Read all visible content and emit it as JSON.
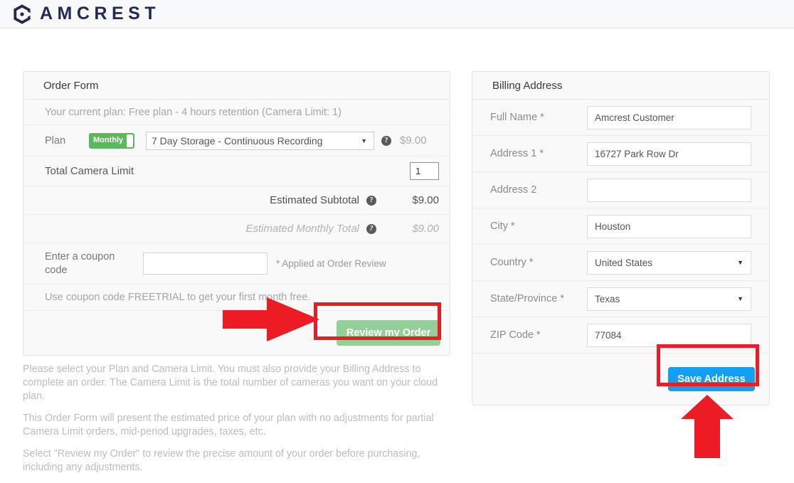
{
  "header": {
    "brand": "AMCREST",
    "logo_icon": "amcrest-hexagon-logo-icon"
  },
  "order_form": {
    "title": "Order Form",
    "current_plan": "Your current plan: Free plan - 4 hours retention (Camera Limit: 1)",
    "plan_label": "Plan",
    "billing_toggle": "Monthly",
    "plan_selected": "7 Day Storage - Continuous Recording",
    "plan_help_icon": "?",
    "plan_price": "$9.00",
    "camera_limit_label": "Total Camera Limit",
    "camera_limit_value": "1",
    "subtotal_label": "Estimated Subtotal",
    "subtotal_value": "$9.00",
    "monthly_total_label": "Estimated Monthly Total",
    "monthly_total_value": "$9.00",
    "coupon_label": "Enter a coupon code",
    "coupon_value": "",
    "coupon_placeholder": "",
    "coupon_note": "* Applied at Order Review",
    "coupon_hint": "Use coupon code FREETRIAL to get your first month free.",
    "review_button": "Review my Order"
  },
  "billing": {
    "title": "Billing Address",
    "fields": [
      {
        "label": "Full Name *",
        "value": "Amcrest Customer",
        "type": "text"
      },
      {
        "label": "Address 1 *",
        "value": "16727 Park Row Dr",
        "type": "text"
      },
      {
        "label": "Address 2",
        "value": "",
        "type": "text"
      },
      {
        "label": "City *",
        "value": "Houston",
        "type": "text"
      },
      {
        "label": "Country *",
        "value": "United States",
        "type": "select"
      },
      {
        "label": "State/Province *",
        "value": "Texas",
        "type": "select"
      },
      {
        "label": "ZIP Code *",
        "value": "77084",
        "type": "text"
      }
    ],
    "save_button": "Save Address"
  },
  "notes": [
    "Please select your Plan and Camera Limit. You must also provide your Billing Address to complete an order. The Camera Limit is the total number of cameras you want on your cloud plan.",
    "This Order Form will present the estimated price of your plan with no adjustments for partial Camera Limit orders, mid-period upgrades, taxes, etc.",
    "Select \"Review my Order\" to review the precise amount of your order before purchasing, including any adjustments."
  ],
  "annotations": {
    "highlight_color": "#ed1c24",
    "arrow_right_target": "Review my Order",
    "arrow_up_target": "Save Address"
  },
  "colors": {
    "brand_navy": "#242a52",
    "toggle_green": "#5cb85c",
    "review_button_green": "#93cf96",
    "save_button_blue": "#139ef2",
    "annotation_red": "#ed1c24"
  }
}
